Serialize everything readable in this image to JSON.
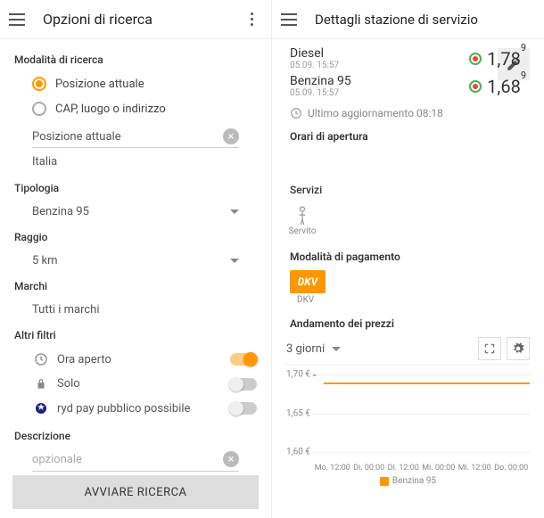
{
  "left": {
    "title": "Opzioni di ricerca",
    "mode": {
      "label": "Modalità di ricerca",
      "option_current": "Posizione attuale",
      "option_address": "CAP, luogo o indirizzo",
      "input_value": "Posizione attuale",
      "country": "Italia"
    },
    "type": {
      "label": "Tipologia",
      "value": "Benzina 95"
    },
    "radius": {
      "label": "Raggio",
      "value": "5 km"
    },
    "brands": {
      "label": "Marchi",
      "value": "Tutti i marchi"
    },
    "filters": {
      "label": "Altri filtri",
      "open_now": "Ora aperto",
      "solo": "Solo",
      "rydpay": "ryd pay pubblico possibile"
    },
    "description": {
      "label": "Descrizione",
      "placeholder": "opzionale"
    },
    "search_button": "AVVIARE RICERCA"
  },
  "right": {
    "title": "Dettagli stazione di servizio",
    "fuels": [
      {
        "name": "Diesel",
        "time": "05.09. 15:57",
        "price_main": "1,78",
        "price_sup": "9"
      },
      {
        "name": "Benzina 95",
        "time": "05.09. 15:57",
        "price_main": "1,68",
        "price_sup": "9"
      }
    ],
    "last_update": "Ultimo aggiornamento 08:18",
    "hours_label": "Orari di apertura",
    "services": {
      "label": "Servizi",
      "served": "Servito"
    },
    "payment": {
      "label": "Modalità di pagamento",
      "dkv_badge": "DKV",
      "dkv_caption": "DKV"
    },
    "trend": {
      "label": "Andamento dei prezzi",
      "range": "3 giorni",
      "legend": "Benzina 95"
    }
  },
  "chart_data": {
    "type": "line",
    "title": "Andamento dei prezzi",
    "ylabel": "€",
    "ylim": [
      1.6,
      1.7
    ],
    "yticks": [
      1.6,
      1.65,
      1.7
    ],
    "x": [
      "Mo. 12:00",
      "Di. 00:00",
      "Di. 12:00",
      "Mi. 00:00",
      "Mi. 12:00",
      "Do. 00:00"
    ],
    "series": [
      {
        "name": "Benzina 95",
        "values": [
          1.7,
          1.69,
          1.69,
          1.69,
          1.69,
          1.69
        ]
      }
    ]
  }
}
